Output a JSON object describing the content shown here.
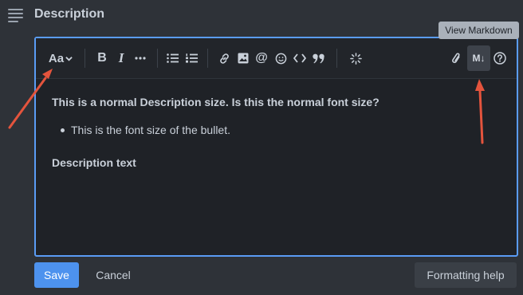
{
  "header": {
    "title": "Description",
    "icon": "description-lines-icon"
  },
  "tooltip": {
    "text": "View Markdown"
  },
  "toolbar": {
    "font_size_label": "Aa",
    "items": [
      "chevron-down-icon",
      "bold-icon",
      "italic-icon",
      "more-icon",
      "bullet-list-icon",
      "numbered-list-icon",
      "link-icon",
      "image-icon",
      "mention-icon",
      "emoji-icon",
      "code-icon",
      "quote-icon",
      "sparkle-icon",
      "attachment-icon",
      "markdown-icon",
      "help-icon"
    ],
    "markdown_label": "M↓"
  },
  "content": {
    "line1": "This is a normal Description size. Is this the normal font size?",
    "bullet1": "This is the font size of the bullet.",
    "line2": "Description text"
  },
  "footer": {
    "save_label": "Save",
    "cancel_label": "Cancel",
    "help_label": "Formatting help"
  },
  "colors": {
    "accent": "#4d92ee",
    "annotation_arrow": "#e4543d",
    "focus_border": "#5a9cf5"
  }
}
